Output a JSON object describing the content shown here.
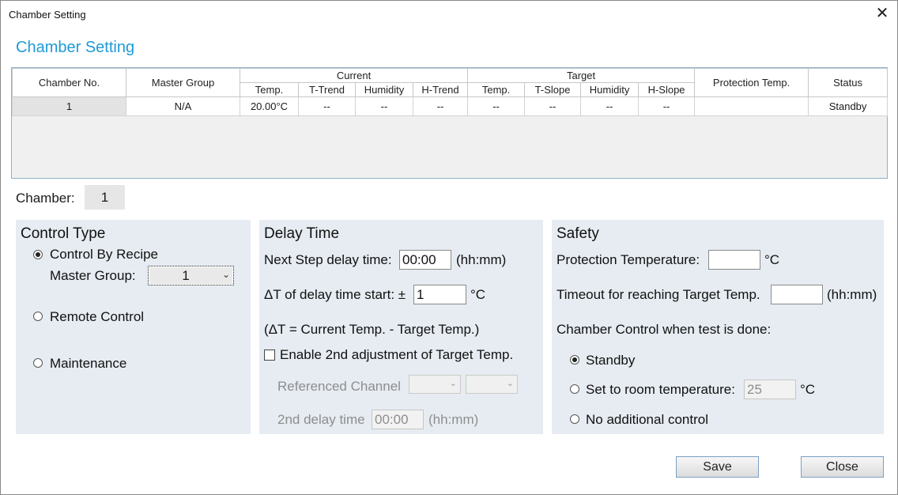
{
  "window": {
    "title": "Chamber Setting",
    "close_glyph": "✕",
    "heading": "Chamber Setting"
  },
  "table": {
    "headers": {
      "chamber_no": "Chamber No.",
      "master_group": "Master Group",
      "current": "Current",
      "target": "Target",
      "protection": "Protection Temp.",
      "status": "Status",
      "current_sub": [
        "Temp.",
        "T-Trend",
        "Humidity",
        "H-Trend"
      ],
      "target_sub": [
        "Temp.",
        "T-Slope",
        "Humidity",
        "H-Slope"
      ]
    },
    "rows": [
      [
        "1",
        "N/A",
        "20.00°C",
        "--",
        "--",
        "--",
        "--",
        "--",
        "--",
        "--",
        "",
        "Standby"
      ]
    ]
  },
  "chamber": {
    "label": "Chamber:",
    "value": "1"
  },
  "control_type": {
    "title": "Control Type",
    "by_recipe": "Control By Recipe",
    "master_group_label": "Master Group:",
    "master_group_value": "1",
    "remote": "Remote Control",
    "maintenance": "Maintenance",
    "selected": "by_recipe"
  },
  "delay_time": {
    "title": "Delay Time",
    "next_step_label": "Next Step delay time:",
    "next_step_value": "00:00",
    "next_step_unit": "(hh:mm)",
    "dt_label": "ΔT of delay time start: ±",
    "dt_value": "1",
    "dt_unit": "°C",
    "formula": "(ΔT = Current Temp. - Target Temp.)",
    "enable_2nd": "Enable 2nd adjustment of Target Temp.",
    "enable_2nd_checked": false,
    "ref_channel_label": "Referenced Channel",
    "second_delay_label": "2nd delay time",
    "second_delay_value": "00:00",
    "second_delay_unit": "(hh:mm)"
  },
  "safety": {
    "title": "Safety",
    "protection_label": "Protection Temperature:",
    "protection_value": "",
    "protection_unit": "°C",
    "timeout_label": "Timeout for reaching Target Temp.",
    "timeout_value": "",
    "timeout_unit": "(hh:mm)",
    "done_label": "Chamber Control when test is done:",
    "standby": "Standby",
    "room_temp": "Set to room temperature:",
    "room_temp_value": "25",
    "room_temp_unit": "°C",
    "no_control": "No additional control",
    "selected": "standby"
  },
  "buttons": {
    "save": "Save",
    "close": "Close"
  }
}
